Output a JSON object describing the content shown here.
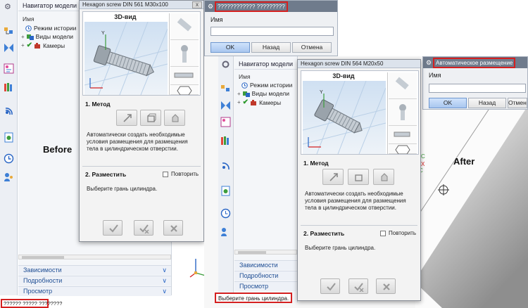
{
  "before": {
    "label": "Before",
    "gear_glyph": "⚙",
    "navigator_title": "Навигатор модели",
    "column_name": "Имя",
    "tree": [
      {
        "label": "Режим истории",
        "icon": "history-clock-icon"
      },
      {
        "label": "Виды модели",
        "icon": "model-views-icon"
      },
      {
        "label": "Камеры",
        "icon": "camera-check-icon"
      }
    ],
    "accordion": [
      {
        "label": "Зависимости"
      },
      {
        "label": "Подробности"
      },
      {
        "label": "Просмотр"
      }
    ],
    "status_text": "?????? ????? ????????",
    "dialog_caption": "???????????? ?????????",
    "chevron": "∨"
  },
  "dialog_before": {
    "title": "Hexagon screw DIN 561 M30x100",
    "view_label": "3D-вид",
    "method_title": "1. Метод",
    "method_desc": "Автоматически создать необходимые условия размещения для размещения тела в цилиндрическом отверстии.",
    "place_title": "2. Разместить",
    "repeat_label": "Повторить",
    "hint": "Выберите грань цилиндра.",
    "close_glyph": "x"
  },
  "after": {
    "label": "After",
    "navigator_title": "Навигатор модели",
    "column_name": "Имя",
    "tree": [
      {
        "label": "Режим истории",
        "icon": "history-clock-icon"
      },
      {
        "label": "Виды модели",
        "icon": "model-views-icon"
      },
      {
        "label": "Камеры",
        "icon": "camera-check-icon"
      }
    ],
    "accordion": [
      {
        "label": "Зависимости"
      },
      {
        "label": "Подробности"
      },
      {
        "label": "Просмотр"
      }
    ],
    "status_text": "Выберите грань цилиндра.",
    "panel_caption": "Автоматическое размещение"
  },
  "dialog_after": {
    "title": "Hexagon screw DIN 564 M20x50",
    "view_label": "3D-вид",
    "method_title": "1. Метод",
    "method_desc": "Автоматически создать необходимые условия размещения для размещения тела в цилиндрическом отверстии.",
    "place_title": "2. Разместить",
    "repeat_label": "Повторить",
    "hint": "Выберите грань цилиндра.",
    "close_glyph": "x"
  },
  "panel": {
    "name_label": "Имя",
    "name_value": "",
    "ok": "OK",
    "back": "Назад",
    "cancel": "Отмена"
  },
  "axis": {
    "x": "X",
    "y": "Y",
    "z": "Z",
    "c": "C"
  },
  "colors": {
    "highlight": "#d42020",
    "accent": "#2a66c5",
    "accordion_text": "#1f4e94"
  }
}
